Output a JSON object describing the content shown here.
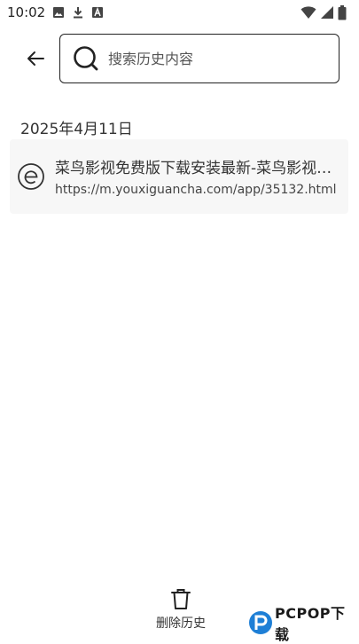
{
  "status_bar": {
    "time": "10:02",
    "icons": [
      "image-icon",
      "download-icon",
      "font-a-icon",
      "wifi-icon",
      "signal-icon",
      "battery-icon"
    ]
  },
  "search": {
    "placeholder": "搜索历史内容",
    "value": ""
  },
  "history": {
    "date": "2025年4月11日",
    "items": [
      {
        "title": "菜鸟影视免费版下载安装最新-菜鸟影视免费版下载安装",
        "url": "https://m.youxiguancha.com/app/35132.html",
        "icon": "browser-e-icon"
      }
    ]
  },
  "bottom": {
    "delete_label": "删除历史"
  },
  "watermark": {
    "text": "PCPOP下载"
  },
  "colors": {
    "text": "#222222",
    "item_background": "#f7f7f7",
    "watermark_blue": "#1e7fd6"
  }
}
